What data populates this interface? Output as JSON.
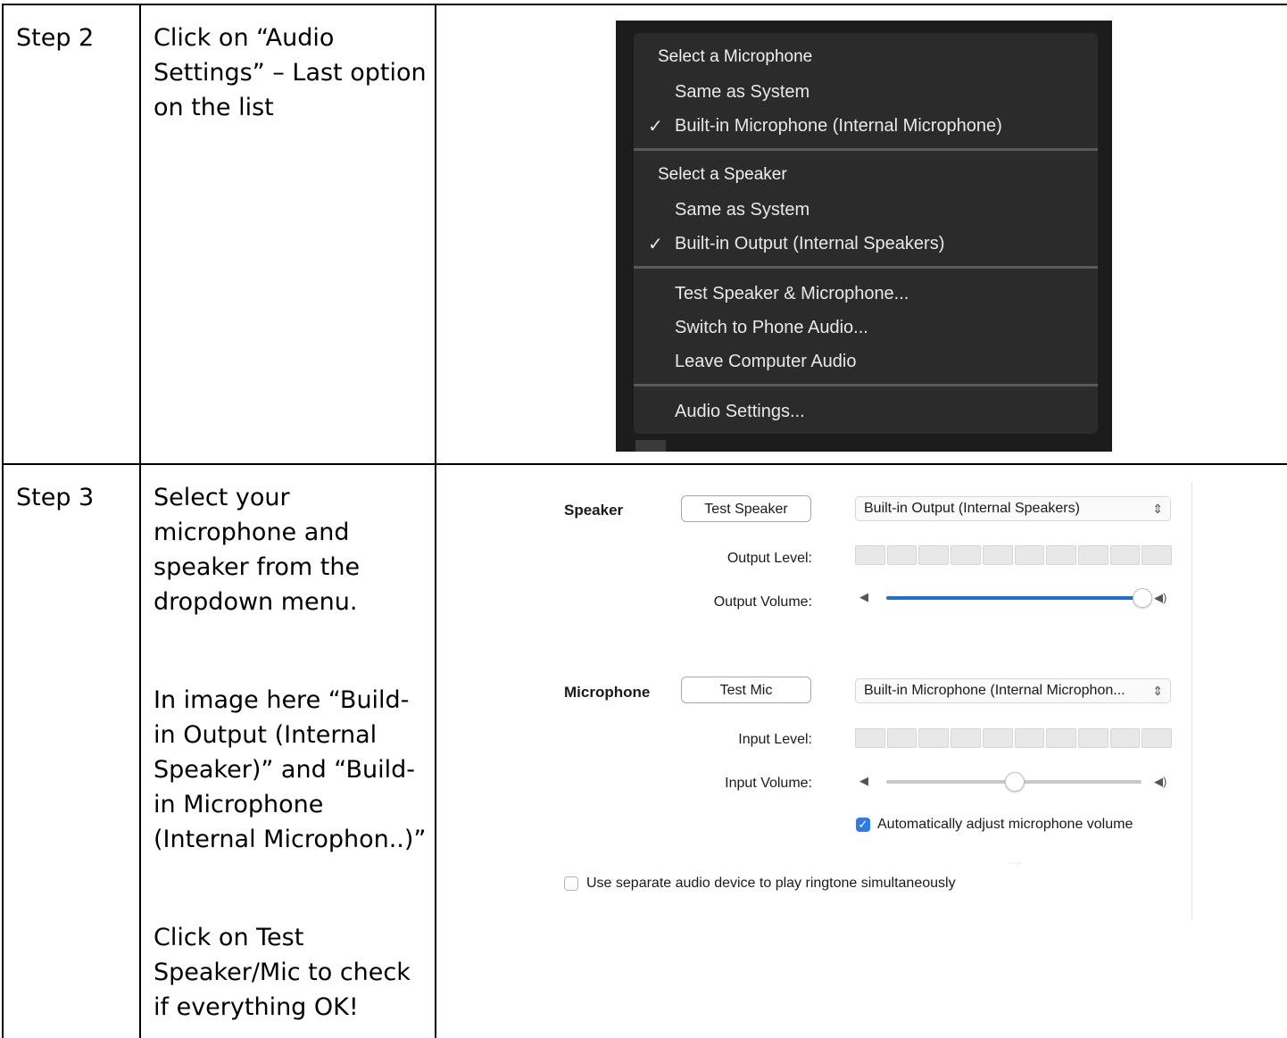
{
  "table": {
    "rows": [
      {
        "step": "Step 2",
        "instructions": [
          "Click on “Audio Settings” – Last option on the list"
        ]
      },
      {
        "step": "Step 3",
        "instructions": [
          "Select your microphone and speaker from the dropdown menu.",
          "In image here “Build-in Output (Internal Speaker)” and “Build-in Microphone (Internal Microphon..)”",
          "Click on Test Speaker/Mic to check if everything OK!"
        ]
      }
    ]
  },
  "audio_menu": {
    "microphone_section": {
      "title": "Select a Microphone",
      "items": [
        "Same as System",
        "Built-in Microphone (Internal Microphone)"
      ],
      "checked_index": 1
    },
    "speaker_section": {
      "title": "Select a Speaker",
      "items": [
        "Same as System",
        "Built-in Output (Internal Speakers)"
      ],
      "checked_index": 1
    },
    "actions": [
      "Test Speaker & Microphone...",
      "Switch to Phone Audio...",
      "Leave Computer Audio"
    ],
    "settings_item": "Audio Settings...",
    "check_glyph": "✓"
  },
  "audio_settings": {
    "speaker": {
      "label": "Speaker",
      "test_button": "Test Speaker",
      "device": "Built-in Output (Internal Speakers)",
      "level_label": "Output Level:",
      "volume_label": "Output Volume:",
      "volume": 1.0
    },
    "microphone": {
      "label": "Microphone",
      "test_button": "Test Mic",
      "device": "Built-in Microphone (Internal Microphon...",
      "level_label": "Input Level:",
      "volume_label": "Input Volume:",
      "volume": 0.5
    },
    "auto_adjust": {
      "label": "Automatically adjust microphone volume",
      "checked": true
    },
    "ringtone": {
      "label": "Use separate audio device to play ringtone simultaneously",
      "checked": false
    },
    "accent_color": "#1f6fce",
    "chevron_icon": "⌃⌄"
  }
}
